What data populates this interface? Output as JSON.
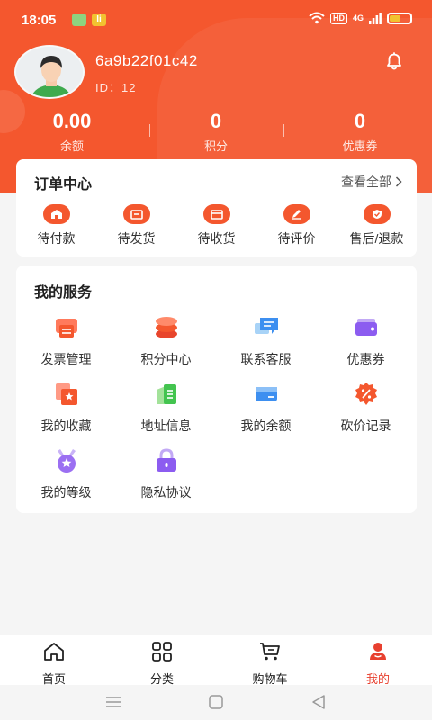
{
  "status_bar": {
    "time": "18:05",
    "app_badge": "Ii",
    "hd": "HD",
    "network": "4G"
  },
  "profile": {
    "username": "6a9b22f01c42",
    "user_id": "ID：12"
  },
  "stats": [
    {
      "value": "0.00",
      "label": "余额"
    },
    {
      "value": "0",
      "label": "积分"
    },
    {
      "value": "0",
      "label": "优惠券"
    }
  ],
  "orders": {
    "title": "订单中心",
    "view_all": "查看全部",
    "items": [
      {
        "label": "待付款",
        "icon": "payment-icon"
      },
      {
        "label": "待发货",
        "icon": "shipping-icon"
      },
      {
        "label": "待收货",
        "icon": "receive-icon"
      },
      {
        "label": "待评价",
        "icon": "review-icon"
      },
      {
        "label": "售后/退款",
        "icon": "refund-icon"
      }
    ]
  },
  "services": {
    "title": "我的服务",
    "items": [
      {
        "label": "发票管理",
        "icon": "invoice-icon"
      },
      {
        "label": "积分中心",
        "icon": "points-icon"
      },
      {
        "label": "联系客服",
        "icon": "chat-icon"
      },
      {
        "label": "优惠券",
        "icon": "coupon-icon"
      },
      {
        "label": "我的收藏",
        "icon": "favorite-icon"
      },
      {
        "label": "地址信息",
        "icon": "address-icon"
      },
      {
        "label": "我的余额",
        "icon": "wallet-icon"
      },
      {
        "label": "砍价记录",
        "icon": "discount-icon"
      },
      {
        "label": "我的等级",
        "icon": "level-medal-icon"
      },
      {
        "label": "隐私协议",
        "icon": "lock-icon"
      }
    ]
  },
  "tabbar": {
    "items": [
      {
        "label": "首页",
        "icon": "home-icon"
      },
      {
        "label": "分类",
        "icon": "category-icon"
      },
      {
        "label": "购物车",
        "icon": "cart-icon"
      },
      {
        "label": "我的",
        "icon": "profile-icon",
        "active": true
      }
    ]
  },
  "colors": {
    "brand": "#f4572e",
    "active_tab": "#e8402f",
    "background": "#f5f5f5"
  }
}
